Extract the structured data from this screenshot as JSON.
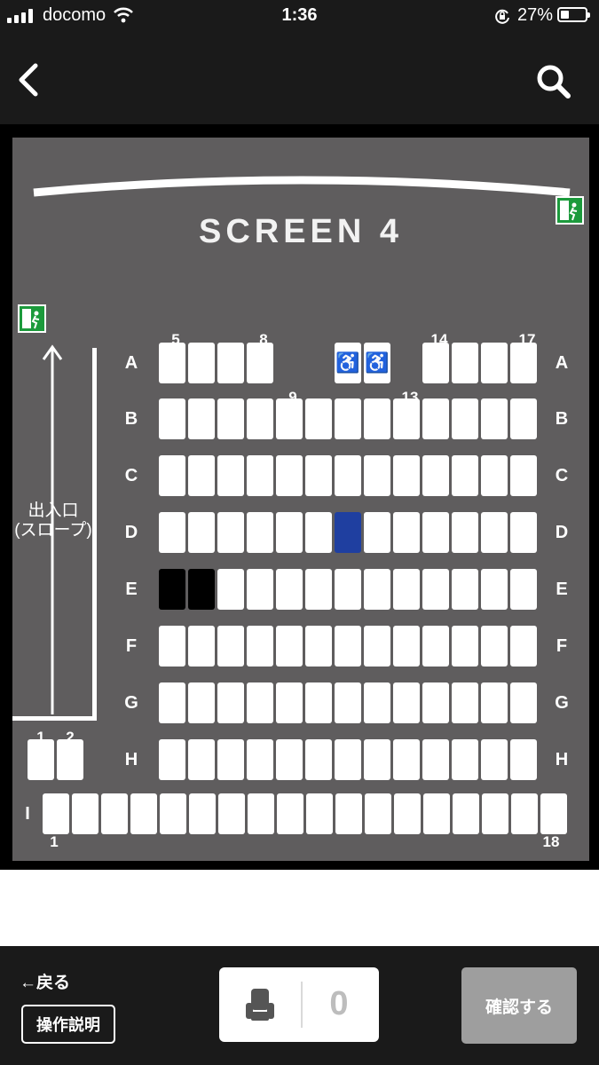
{
  "status_bar": {
    "carrier": "docomo",
    "time": "1:36",
    "battery": "27%"
  },
  "nav": {
    "back_icon": "chevron-left-icon",
    "search_icon": "search-icon"
  },
  "theater": {
    "screen_label": "SCREEN 4",
    "entrance_label_1": "出入口",
    "entrance_label_2": "(スロープ)",
    "row_labels": [
      "A",
      "B",
      "C",
      "D",
      "E",
      "F",
      "G",
      "H"
    ],
    "row_i_label": "I",
    "col_labels": {
      "c5": "5",
      "c8": "8",
      "c9": "9",
      "c13": "13",
      "c14": "14",
      "c17": "17",
      "h1": "1",
      "h2": "2",
      "i1": "1",
      "i18": "18"
    },
    "wheelchair_icon": "♿",
    "seat_status": {
      "reserved": [
        "E-5",
        "E-6"
      ],
      "selected": [
        "D-11"
      ],
      "wheelchair": [
        "A-11",
        "A-12"
      ]
    }
  },
  "footer": {
    "back_label": "←戻る",
    "help_label": "操作説明",
    "selected_count": "0",
    "confirm_label": "確認する"
  },
  "colors": {
    "hall_bg": "#5f5d5e",
    "selected_seat": "#1f3fa0",
    "reserved_seat": "#000000",
    "exit_sign": "#1c9a3c",
    "confirm_disabled": "#9e9e9e"
  }
}
